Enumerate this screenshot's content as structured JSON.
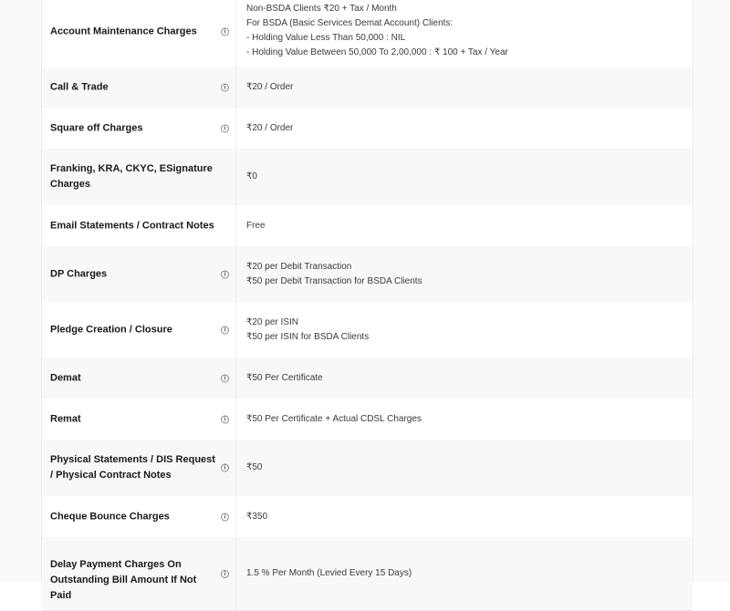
{
  "charges": [
    {
      "label": "Account Maintenance Charges",
      "lines": [
        "Non-BSDA Clients ₹20 + Tax / Month",
        "For BSDA (Basic Services Demat Account) Clients:",
        "- Holding Value Less Than 50,000 : NIL",
        "- Holding Value Between 50,000 To 2,00,000 : ₹ 100 + Tax / Year"
      ]
    },
    {
      "label": "Call & Trade",
      "lines": [
        "₹20 / Order"
      ]
    },
    {
      "label": "Square off Charges",
      "lines": [
        "₹20 / Order"
      ]
    },
    {
      "label": "Franking, KRA, CKYC, ESignature Charges",
      "lines": [
        "₹0"
      ]
    },
    {
      "label": "Email Statements / Contract Notes",
      "lines": [
        "Free"
      ]
    },
    {
      "label": "DP Charges",
      "lines": [
        "₹20 per Debit Transaction",
        "₹50 per Debit Transaction for BSDA Clients"
      ]
    },
    {
      "label": "Pledge Creation / Closure",
      "lines": [
        "₹20 per ISIN",
        "₹50 per ISIN for BSDA Clients"
      ]
    },
    {
      "label": "Demat",
      "lines": [
        "₹50 Per Certificate"
      ]
    },
    {
      "label": "Remat",
      "lines": [
        "₹50 Per Certificate + Actual CDSL Charges"
      ]
    },
    {
      "label": "Physical Statements / DIS Request / Physical Contract Notes",
      "lines": [
        "₹50"
      ]
    },
    {
      "label": "Cheque Bounce Charges",
      "lines": [
        "₹350"
      ]
    },
    {
      "label": "Delay Payment Charges On Outstanding Bill Amount If Not Paid",
      "lines": [
        "1.5 % Per Month (Levied Every 15 Days)"
      ]
    }
  ],
  "info_icon": "info-icon",
  "info_glyph": "i"
}
